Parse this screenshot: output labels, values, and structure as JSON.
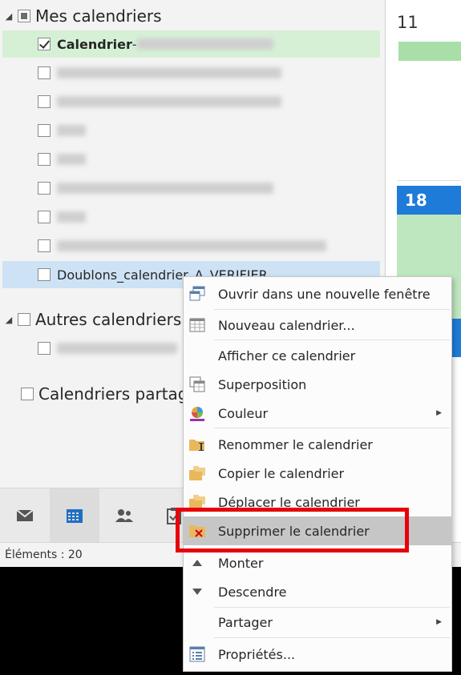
{
  "folder_pane": {
    "my_calendars": {
      "label": "Mes calendriers",
      "items": [
        {
          "label": "Calendrier",
          "suffix": " - ",
          "checked": true,
          "state": "selected",
          "redacted": true
        },
        {
          "label": "",
          "checked": false,
          "redacted": true
        },
        {
          "label": "",
          "checked": false,
          "redacted": true
        },
        {
          "label": "",
          "checked": false,
          "redacted": true
        },
        {
          "label": "",
          "checked": false,
          "redacted": true
        },
        {
          "label": "",
          "checked": false,
          "redacted": true
        },
        {
          "label": "",
          "checked": false,
          "redacted": true
        },
        {
          "label": "",
          "checked": false,
          "redacted": true
        },
        {
          "label": "Doublons_calendrier_A_VERIFIER",
          "checked": false,
          "state": "focused"
        }
      ]
    },
    "other_calendars": {
      "label": "Autres calendriers",
      "items": [
        {
          "label": "",
          "checked": false,
          "redacted": true
        }
      ]
    },
    "shared_calendars": {
      "label": "Calendriers partag"
    }
  },
  "navigation": {
    "items": [
      {
        "icon": "mail-icon",
        "active": false
      },
      {
        "icon": "calendar-icon",
        "active": true
      },
      {
        "icon": "people-icon",
        "active": false
      },
      {
        "icon": "tasks-icon",
        "active": false
      }
    ]
  },
  "status_bar": {
    "items_label": "Éléments : 20"
  },
  "calendar_view": {
    "day_11": "11",
    "day_18": "18"
  },
  "context_menu": {
    "items": [
      {
        "label": "Ouvrir dans une nouvelle fenêtre",
        "icon": "new-window-icon"
      },
      {
        "label": "Nouveau calendrier...",
        "icon": "new-calendar-icon"
      },
      {
        "label": "Afficher ce calendrier",
        "icon": ""
      },
      {
        "label": "Superposition",
        "icon": "overlay-icon"
      },
      {
        "label": "Couleur",
        "icon": "color-palette-icon",
        "submenu": true
      },
      {
        "label": "Renommer le calendrier",
        "icon": "rename-folder-icon"
      },
      {
        "label": "Copier le calendrier",
        "icon": "copy-folder-icon"
      },
      {
        "label": "Déplacer le calendrier",
        "icon": "move-folder-icon"
      },
      {
        "label": "Supprimer le calendrier",
        "icon": "delete-folder-icon",
        "highlighted": true
      },
      {
        "label": "Monter",
        "icon": "arrow-up-icon"
      },
      {
        "label": "Descendre",
        "icon": "arrow-down-icon"
      },
      {
        "label": "Partager",
        "icon": "",
        "submenu": true
      },
      {
        "label": "Propriétés...",
        "icon": "properties-icon"
      }
    ],
    "submenu_glyph": "▶"
  },
  "colors": {
    "accent_blue": "#1f7bd8",
    "selected_green": "#d6f0d6",
    "highlight_red": "#e8000b"
  }
}
